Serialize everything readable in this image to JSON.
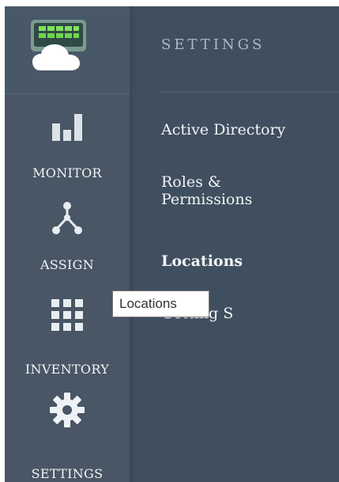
{
  "sidebar": {
    "logo_icon": "cloud-monitor-icon",
    "items": [
      {
        "label": "MONITOR",
        "icon": "bar-chart-icon"
      },
      {
        "label": "ASSIGN",
        "icon": "network-node-icon"
      },
      {
        "label": "INVENTORY",
        "icon": "grid-icon"
      },
      {
        "label": "SETTINGS",
        "icon": "gear-icon"
      }
    ]
  },
  "panel": {
    "title": "SETTINGS",
    "items": [
      {
        "label": "Active Directory",
        "active": false
      },
      {
        "label": "Roles & Permissions",
        "active": false
      },
      {
        "label": "Locations",
        "active": true
      },
      {
        "label": "Getting S",
        "active": false
      }
    ]
  },
  "tooltip": {
    "text": "Locations"
  },
  "colors": {
    "rail_bg": "#485665",
    "panel_bg": "#404f5f",
    "text": "#f1f4f7",
    "muted_title": "#aeb9c4",
    "logo_green": "#6ed54f",
    "logo_dark": "#3f5569"
  }
}
